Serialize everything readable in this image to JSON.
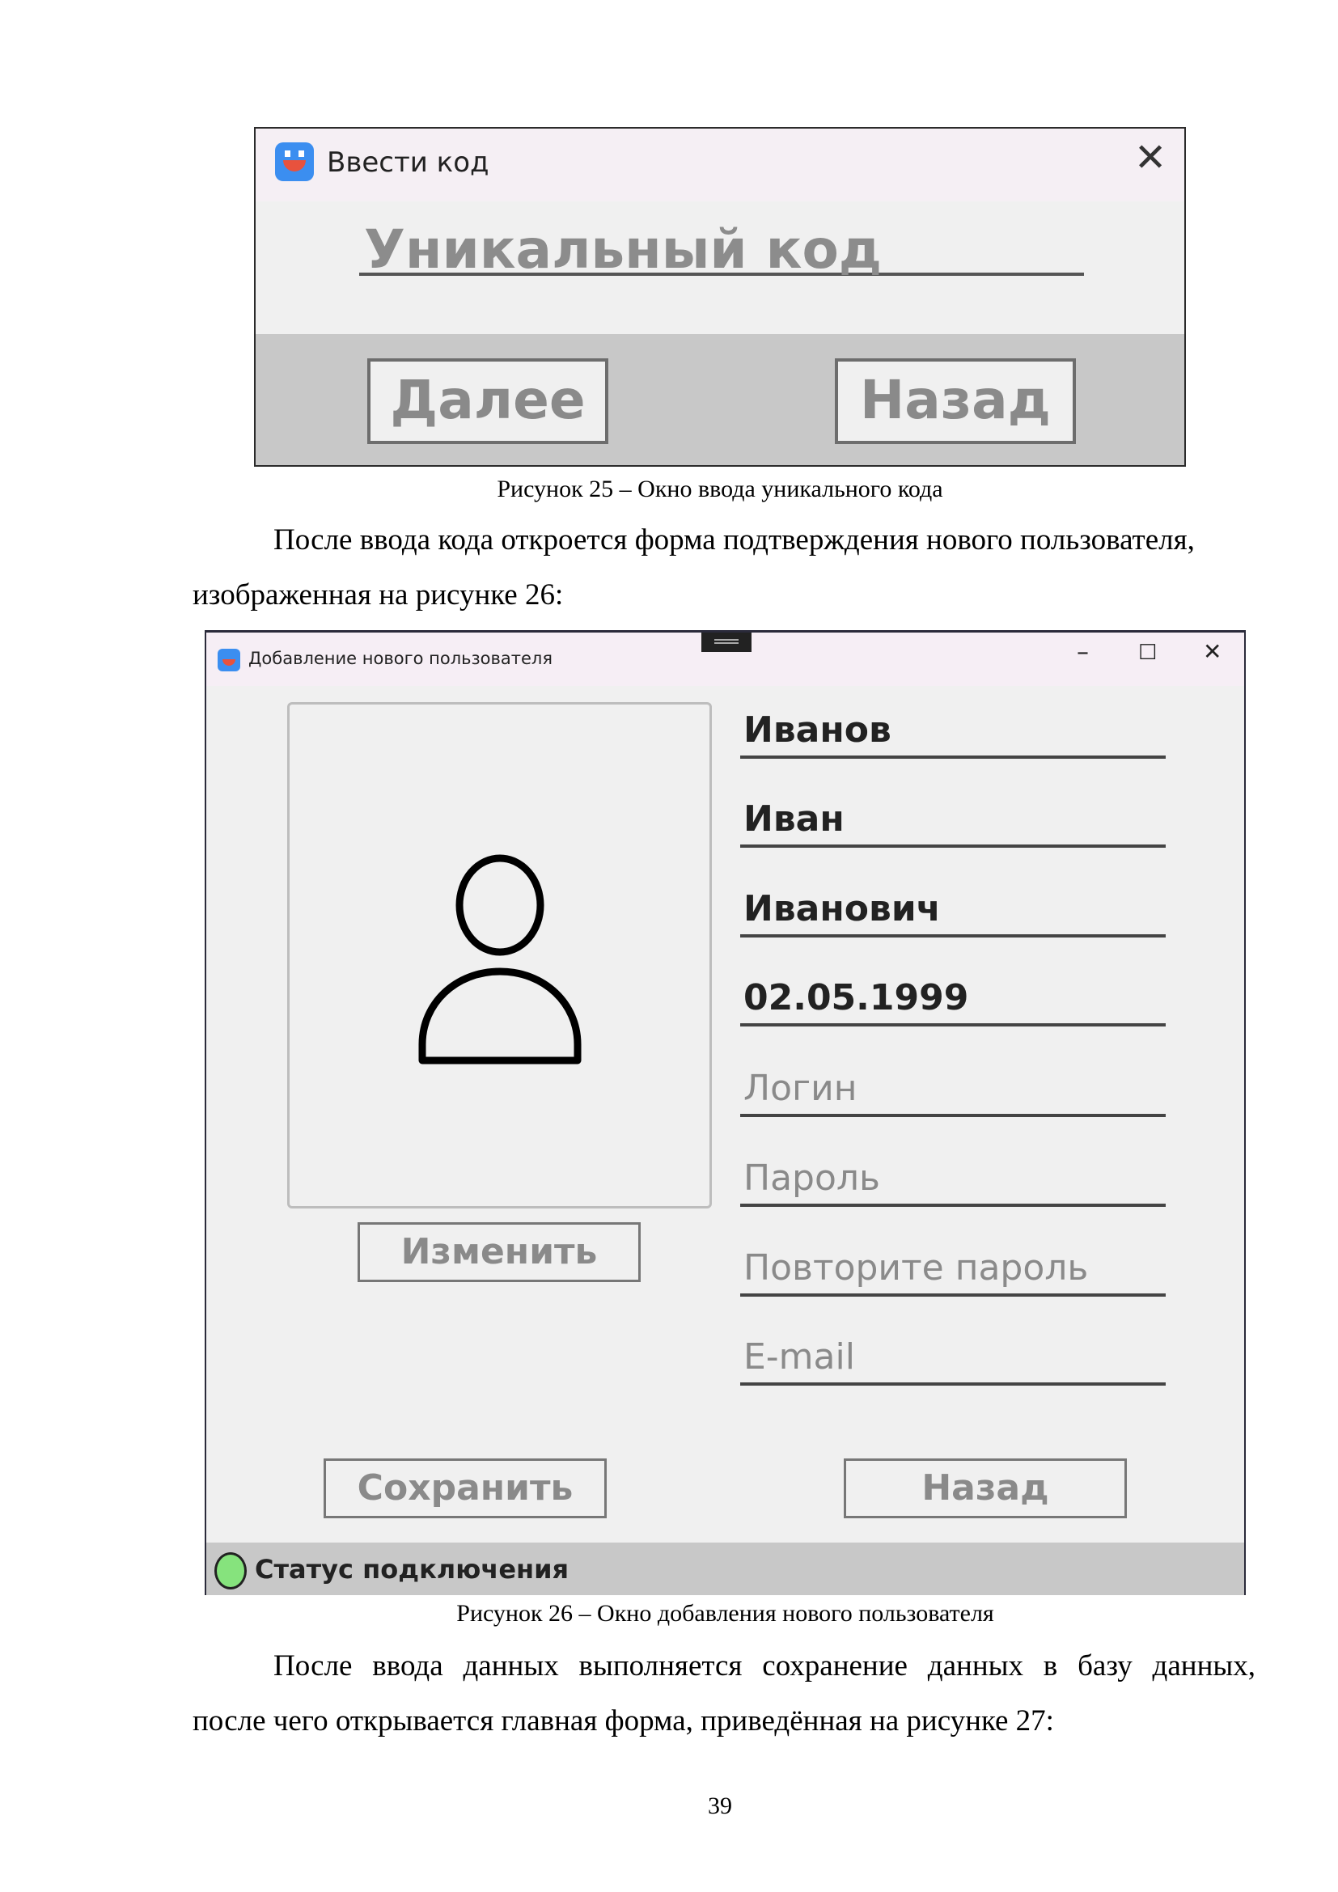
{
  "figure25": {
    "window_title": "Ввести код",
    "code_placeholder": "Уникальный код",
    "next_button": "Далее",
    "back_button": "Назад",
    "caption": "Рисунок 25 – Окно ввода уникального кода"
  },
  "paragraph1": {
    "line1": "После ввода кода откроется форма подтверждения нового пользователя,",
    "line2": "изображенная на рисунке 26:"
  },
  "figure26": {
    "window_title": "Добавление нового пользователя",
    "controls": {
      "minimize": "–",
      "maximize": "☐",
      "close": "✕"
    },
    "fields": {
      "surname": "Иванов",
      "name": "Иван",
      "patronymic": "Иванович",
      "birthdate": "02.05.1999",
      "login_placeholder": "Логин",
      "password_placeholder": "Пароль",
      "repeat_password_placeholder": "Повторите пароль",
      "email_placeholder": "E-mail"
    },
    "change_button": "Изменить",
    "save_button": "Сохранить",
    "back_button": "Назад",
    "status_text": "Статус подключения",
    "status_color": "#86e37d",
    "avatar_icon": "user-icon",
    "caption": "Рисунок 26 – Окно добавления нового пользователя"
  },
  "paragraph2": {
    "line1": "После ввода данных выполняется сохранение данных в базу данных,",
    "line2": "после чего открывается главная форма, приведённая на рисунке 27:"
  },
  "page_number": "39"
}
